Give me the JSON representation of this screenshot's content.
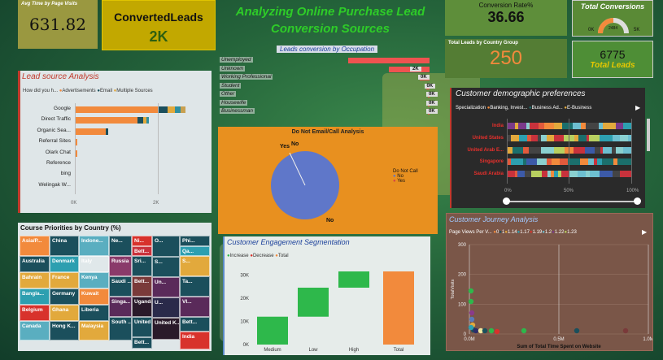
{
  "title": {
    "line1": "Analyzing Online Purchase Lead",
    "line2": "Conversion Sources"
  },
  "kpis": {
    "avg_time": {
      "label": "Avg Time by Page Visits",
      "value": "631.82"
    },
    "converted": {
      "label": "ConvertedLeads",
      "value": "2K"
    },
    "conv_rate": {
      "label": "Conversion Rate%",
      "value": "36.66"
    },
    "total_conv": {
      "label": "Total Conversions",
      "gauge_min": "0K",
      "gauge_val": "2484",
      "gauge_max": "5K"
    },
    "country_group": {
      "label": "Total Leads by Country Group",
      "value": "250"
    },
    "total_leads": {
      "value": "6775",
      "label": "Total Leads"
    }
  },
  "lead_source": {
    "title": "Lead source Analysis",
    "legend_label": "How did you h...",
    "legend": [
      "Advertisements",
      "Email",
      "Multiple Sources"
    ],
    "colors": [
      "#f28a3c",
      "#1b4f5c",
      "#e2a93c"
    ],
    "rows": [
      "Google",
      "Direct Traffic",
      "Organic Sea...",
      "Referral Sites",
      "Olark Chat",
      "Reference",
      "bing",
      "Welingak W..."
    ],
    "axis": [
      "0K",
      "2K"
    ]
  },
  "occupation": {
    "title": "Leads conversion by Occupation",
    "rows": [
      {
        "label": "Unemployed",
        "value": ""
      },
      {
        "label": "Unknown",
        "value": "2K"
      },
      {
        "label": "Working Professional",
        "value": "0K"
      },
      {
        "label": "Student",
        "value": "0K"
      },
      {
        "label": "Other",
        "value": "0K"
      },
      {
        "label": "Housewife",
        "value": "0K"
      },
      {
        "label": "Businessman",
        "value": "0K"
      }
    ]
  },
  "donotcall": {
    "title": "Do Not Email/Call Analysis",
    "legend_title": "Do Not Call",
    "legend": [
      "No",
      "Yes"
    ],
    "label_yes": "Yes",
    "label_no": "No",
    "label_no_small": "No"
  },
  "course": {
    "title": "Course Priorities by Country (%)",
    "cells": [
      "Asia/P...",
      "China",
      "Indone...",
      "Ne...",
      "Ni...",
      "O...",
      "Phi...",
      "Qa...",
      "Australia",
      "Denmark",
      "Italy",
      "Russia",
      "Sri...",
      "S...",
      "S...",
      "Ta...",
      "Bahrain",
      "France",
      "Kenya",
      "Saudi ...",
      "Bangla...",
      "Germany",
      "Kuwait",
      "Uganda",
      "U...",
      "VI...",
      "Belgium",
      "Ghana",
      "Liberia",
      "Singa...",
      "United A...",
      "Canada",
      "Hong K...",
      "Malaysia",
      "South ...",
      "United K...",
      "India",
      "Bett...",
      "Bett...",
      "Bett...",
      "Bett...",
      "Bett...",
      "Bett...",
      "Un...",
      "Un..."
    ]
  },
  "engagement": {
    "title": "Customer Engagement Segmentation",
    "legend": [
      "Increase",
      "Decrease",
      "Total"
    ],
    "yaxis": [
      "30K",
      "20K",
      "10K",
      "0K"
    ],
    "categories": [
      "Medium",
      "Low",
      "High",
      "Total"
    ]
  },
  "demographic": {
    "title": "Customer demographic preferences",
    "legend_label": "Specialization",
    "legend": [
      "Banking, Invest...",
      "Business Ad...",
      "E-Business"
    ],
    "rows": [
      "India",
      "United States",
      "United Arab E...",
      "Singapore",
      "Saudi Arabia"
    ],
    "axis": [
      "0%",
      "50%",
      "100%"
    ]
  },
  "journey": {
    "title": "Customer Journey Analysis",
    "legend_label": "Page Views Per V...",
    "legend": [
      "0",
      "1",
      "1.14",
      "1.17",
      "1.19",
      "1.2",
      "1.22",
      "1.23"
    ],
    "yaxis": [
      "300",
      "200",
      "100",
      "0"
    ],
    "xaxis": [
      "0.0M",
      "0.5M",
      "1.0M"
    ],
    "ylabel": "TotalVisits",
    "xlabel": "Sum of Total Time Spent on Website"
  },
  "chart_data": [
    {
      "type": "bar",
      "title": "Lead source Analysis",
      "categories": [
        "Google",
        "Direct Traffic",
        "Organic Sea...",
        "Referral Sites",
        "Olark Chat",
        "Reference",
        "bing",
        "Welingak W..."
      ],
      "series": [
        {
          "name": "Advertisements",
          "values": [
            2000,
            1500,
            750,
            60,
            50,
            20,
            5,
            5
          ]
        }
      ],
      "xlim": [
        0,
        2900
      ]
    },
    {
      "type": "bar",
      "title": "Leads conversion by Occupation",
      "categories": [
        "Unemployed",
        "Unknown",
        "Working Professional",
        "Student",
        "Other",
        "Housewife",
        "Businessman"
      ],
      "values": [
        4000,
        2000,
        480,
        180,
        20,
        10,
        8
      ]
    },
    {
      "type": "pie",
      "title": "Do Not Email/Call Analysis",
      "categories": [
        "No",
        "Yes"
      ],
      "values": [
        99,
        1
      ]
    },
    {
      "type": "bar",
      "title": "Customer Engagement Segmentation",
      "categories": [
        "Medium",
        "Low",
        "High",
        "Total"
      ],
      "values": [
        12000,
        12500,
        7000,
        31500
      ],
      "ylim": [
        0,
        35000
      ]
    }
  ]
}
